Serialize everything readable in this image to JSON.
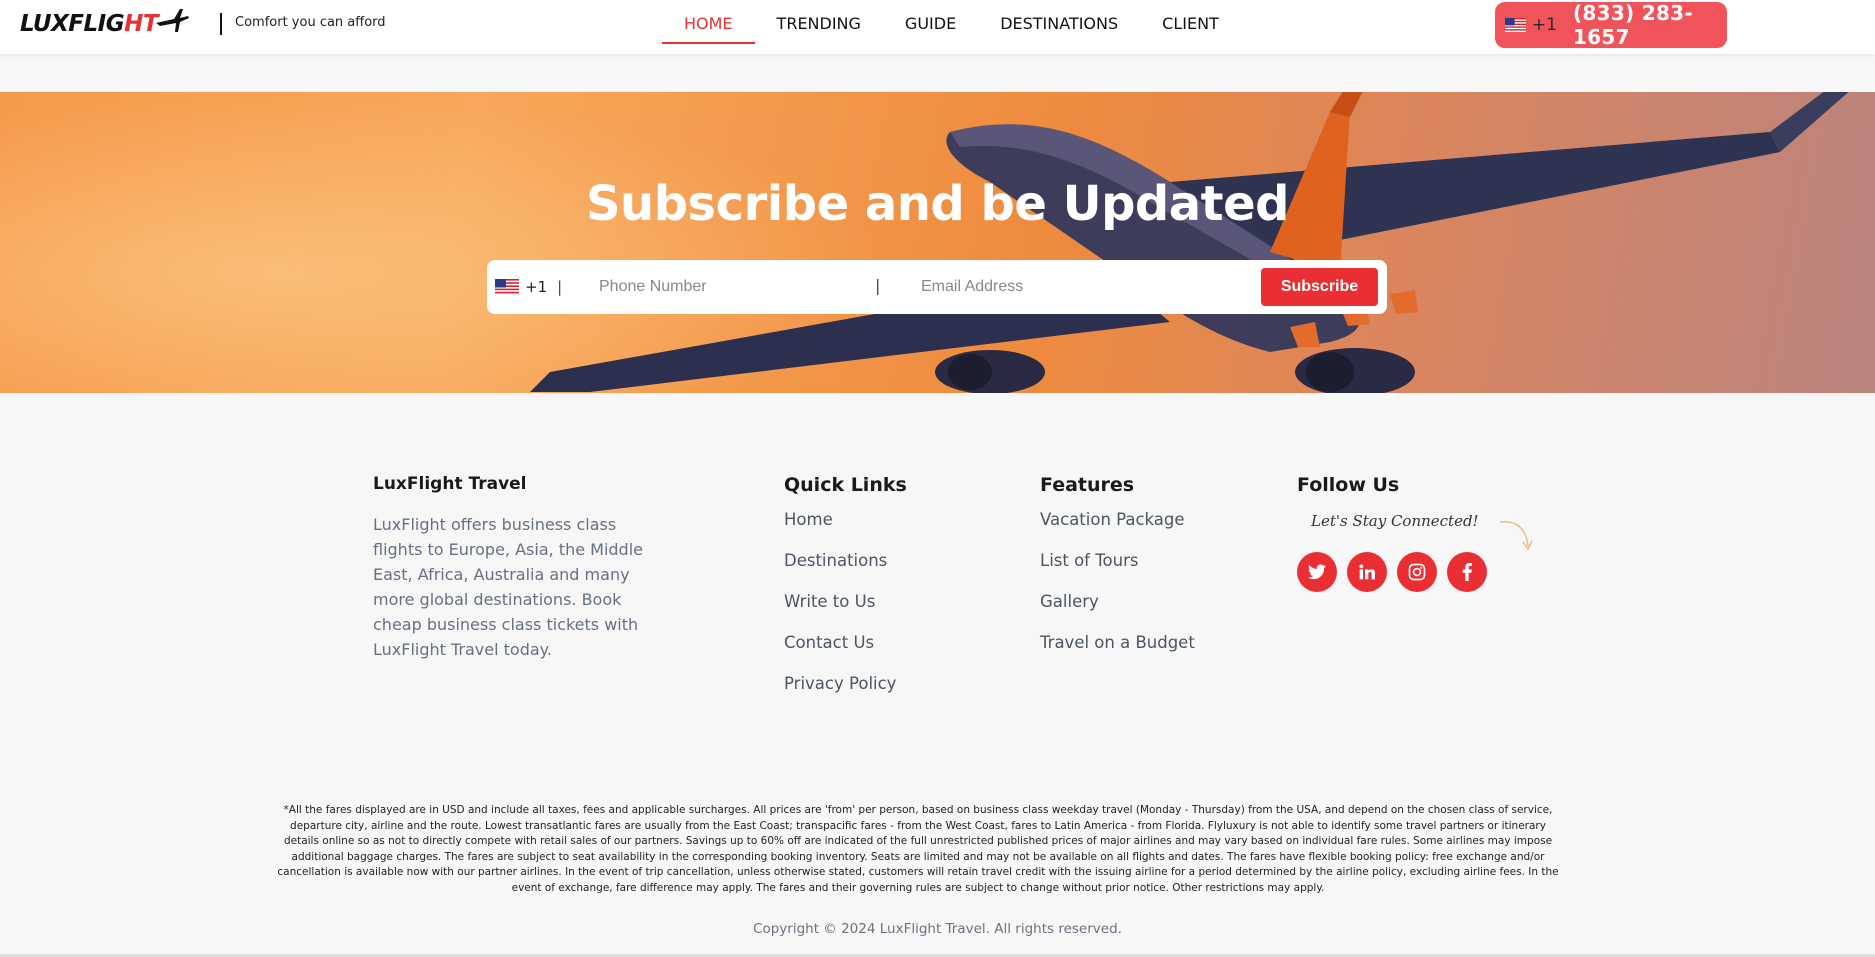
{
  "header": {
    "logo": "LUXFLIGHT",
    "tagline": "Comfort you can afford",
    "nav": [
      "HOME",
      "TRENDING",
      "GUIDE",
      "DESTINATIONS",
      "CLIENT"
    ],
    "active_nav": "HOME",
    "phone_country_code": "+1",
    "phone_number": "(833) 283-1657"
  },
  "hero": {
    "title": "Subscribe and be Updated",
    "country_code": "+1",
    "phone_placeholder": "Phone Number",
    "email_placeholder": "Email Address",
    "subscribe_label": "Subscribe"
  },
  "footer": {
    "about": {
      "title": "LuxFlight Travel",
      "text": "LuxFlight offers business class flights to Europe, Asia, the Middle East, Africa, Australia and many more global destinations. Book cheap business class tickets with LuxFlight Travel today."
    },
    "quick_links": {
      "title": "Quick Links",
      "items": [
        "Home",
        "Destinations",
        "Write to Us",
        "Contact Us",
        "Privacy Policy"
      ]
    },
    "features": {
      "title": "Features",
      "items": [
        "Vacation Package",
        "List of Tours",
        "Gallery",
        "Travel on a Budget"
      ]
    },
    "follow": {
      "title": "Follow Us",
      "tagline": "Let's Stay Connected!",
      "socials": [
        "twitter-icon",
        "linkedin-icon",
        "instagram-icon",
        "facebook-icon"
      ]
    },
    "disclaimer": "*All the fares displayed are in USD and include all taxes, fees and applicable surcharges. All prices are 'from' per person, based on business class weekday travel (Monday - Thursday) from the USA, and depend on the chosen class of service, departure city, airline and the route. Lowest transatlantic fares are usually from the East Coast; transpacific fares - from the West Coast, fares to Latin America - from Florida. Flyluxury is not able to identify some travel partners or itinerary details online so as not to directly compete with retail sales of our partners. Savings up to 60% off are indicated of the full unrestricted published prices of major airlines and may vary based on individual fare rules. Some airlines may impose additional baggage charges. The fares are subject to seat availability in the corresponding booking inventory. Seats are limited and may not be available on all flights and dates. The fares have flexible booking policy: free exchange and/or cancellation is available now with our partner airlines. In the event of trip cancellation, unless otherwise stated, customers will retain travel credit with the issuing airline for a period determined by the airline policy, excluding airline fees. In the event of exchange, fare difference may apply. The fares and their governing rules are subject to change without prior notice. Other restrictions may apply.",
    "copyright": "Copyright © 2024 LuxFlight Travel. All rights reserved."
  },
  "colors": {
    "accent": "#e92f34",
    "phone_pill": "#f0545a",
    "muted_text": "#667085"
  }
}
